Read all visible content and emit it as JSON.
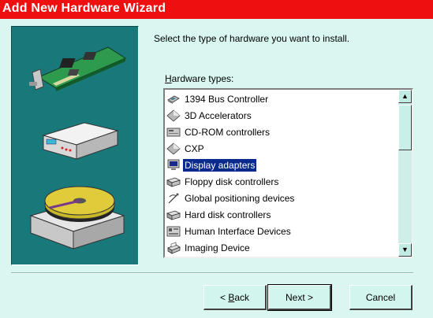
{
  "window": {
    "title": "Add New Hardware Wizard"
  },
  "instruction": "Select the type of hardware you want to install.",
  "list": {
    "label": "Hardware types:",
    "label_mnemonic": "H",
    "label_rest": "ardware types:",
    "selected": "Display adapters",
    "items": [
      {
        "label": "1394 Bus Controller",
        "icon": "bus-controller-icon"
      },
      {
        "label": "3D Accelerators",
        "icon": "diamond-icon"
      },
      {
        "label": "CD-ROM controllers",
        "icon": "cdrom-controller-icon"
      },
      {
        "label": "CXP",
        "icon": "diamond-icon"
      },
      {
        "label": "Display adapters",
        "icon": "monitor-icon"
      },
      {
        "label": "Floppy disk controllers",
        "icon": "drive-controller-icon"
      },
      {
        "label": "Global positioning devices",
        "icon": "gps-icon"
      },
      {
        "label": "Hard disk controllers",
        "icon": "drive-controller-icon"
      },
      {
        "label": "Human Interface Devices",
        "icon": "hid-icon"
      },
      {
        "label": "Imaging Device",
        "icon": "imaging-device-icon"
      }
    ]
  },
  "buttons": {
    "back": "< Back",
    "back_prefix": "< ",
    "back_mnemonic": "B",
    "back_rest": "ack",
    "next": "Next >",
    "cancel": "Cancel"
  },
  "colors": {
    "titlebar": "#ee1010",
    "background": "#d9f7f0",
    "art_panel": "#19787a",
    "selection": "#0b2a8e"
  }
}
